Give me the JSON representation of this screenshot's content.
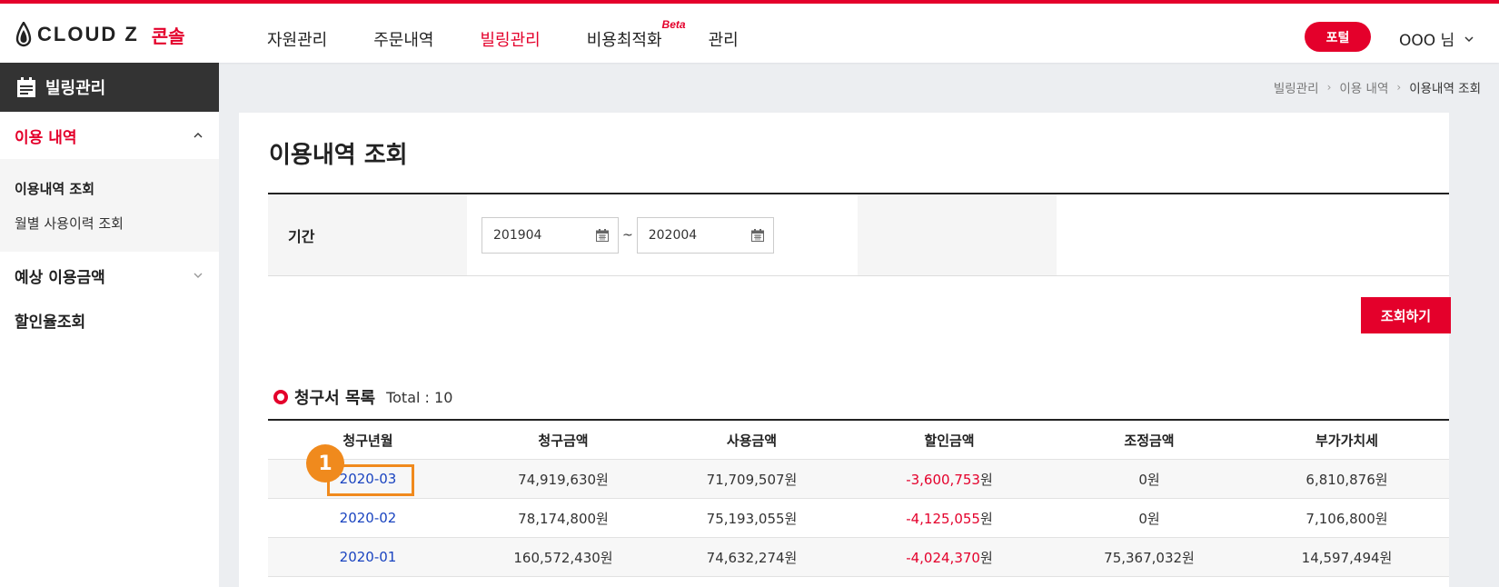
{
  "header": {
    "logo_text": "CLOUD Z",
    "logo_sub": "콘솔",
    "nav": [
      {
        "label": "자원관리"
      },
      {
        "label": "주문내역"
      },
      {
        "label": "빌링관리"
      },
      {
        "label": "비용최적화",
        "badge": "Beta"
      },
      {
        "label": "관리"
      }
    ],
    "active_nav": "빌링관리",
    "portal_label": "포털",
    "user_label": "OOO 님"
  },
  "sidebar": {
    "title": "빌링관리",
    "groups": [
      {
        "label": "이용 내역",
        "expanded": true,
        "items": [
          "이용내역 조회",
          "월별 사용이력 조회"
        ]
      },
      {
        "label": "예상 이용금액",
        "expanded": false
      },
      {
        "label": "할인율조회"
      }
    ]
  },
  "breadcrumb": [
    "빌링관리",
    "이용 내역",
    "이용내역 조회"
  ],
  "main": {
    "title": "이용내역 조회",
    "filter": {
      "label": "기간",
      "from": "201904",
      "to": "202004",
      "separator": "~"
    },
    "search_button": "조회하기",
    "list": {
      "title": "청구서 목록",
      "total_label": "Total : 10"
    },
    "table": {
      "columns": [
        "청구년월",
        "청구금액",
        "사용금액",
        "할인금액",
        "조정금액",
        "부가가치세"
      ],
      "rows": [
        {
          "month": "2020-03",
          "billed": "74,919,630원",
          "used": "71,709,507원",
          "discount_num": "-3,600,753",
          "discount_unit": "원",
          "adjust": "0원",
          "vat": "6,810,876원"
        },
        {
          "month": "2020-02",
          "billed": "78,174,800원",
          "used": "75,193,055원",
          "discount_num": "-4,125,055",
          "discount_unit": "원",
          "adjust": "0원",
          "vat": "7,106,800원"
        },
        {
          "month": "2020-01",
          "billed": "160,572,430원",
          "used": "74,632,274원",
          "discount_num": "-4,024,370",
          "discount_unit": "원",
          "adjust": "75,367,032원",
          "vat": "14,597,494원"
        }
      ]
    }
  },
  "annotation": {
    "step": "1"
  },
  "colors": {
    "accent": "#e4002b",
    "link": "#1a44c0",
    "highlight": "#f08a1d"
  }
}
